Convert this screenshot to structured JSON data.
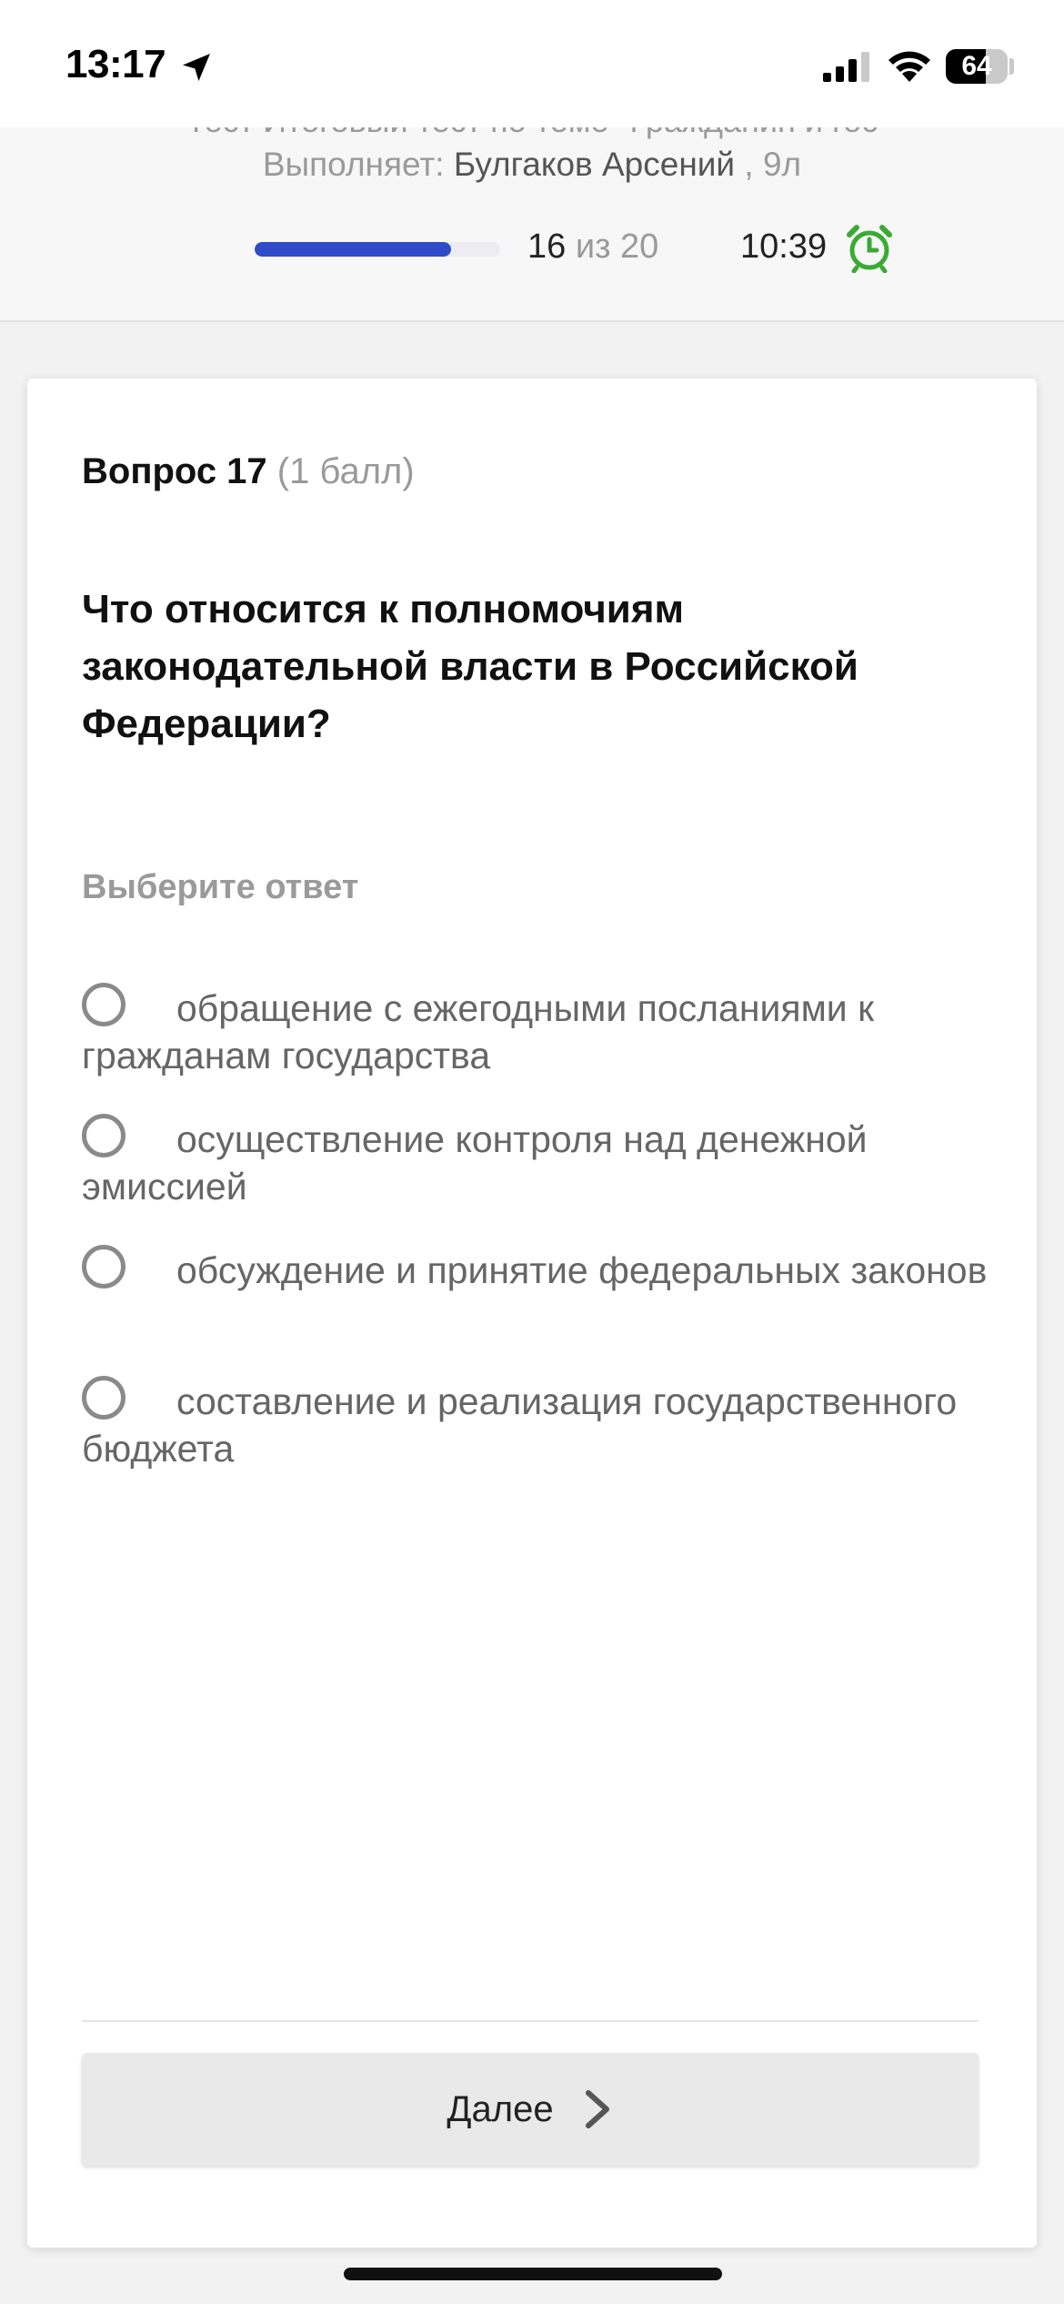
{
  "status_bar": {
    "time": "13:17",
    "battery_text": "64",
    "battery_level": 0.64,
    "icons": [
      "location-arrow-icon",
      "cellular-signal-icon",
      "wifi-icon",
      "battery-icon"
    ]
  },
  "header": {
    "test_title": "Тест Итоговый тест по теме \"Гражданин и гос",
    "performer_label": "Выполняет:",
    "performer_name": "Булгаков Арсений",
    "performer_class": ", 9л",
    "progress_current": "16",
    "progress_of": "из 20",
    "progress_fraction": 0.8,
    "timer": "10:39",
    "colors": {
      "progress": "#2f4bc7",
      "alarm": "#3aaa35"
    },
    "icons": [
      "alarm-clock-icon"
    ]
  },
  "question": {
    "number_label": "Вопрос 17",
    "points_label": "(1 балл)",
    "text": "Что относится к полномочиям законодательной власти в Российской Федерации?",
    "answer_prompt": "Выберите ответ",
    "options": [
      {
        "label": "обращение с ежегодными посланиями к гражданам государства",
        "selected": false
      },
      {
        "label": "осуществление контроля над денежной эмиссией",
        "selected": false
      },
      {
        "label": "обсуждение и принятие федеральных законов",
        "selected": false
      },
      {
        "label": "составление и реализация государственного бюджета",
        "selected": false
      }
    ]
  },
  "footer": {
    "next_label": "Далее",
    "icons": [
      "chevron-right-icon"
    ]
  }
}
